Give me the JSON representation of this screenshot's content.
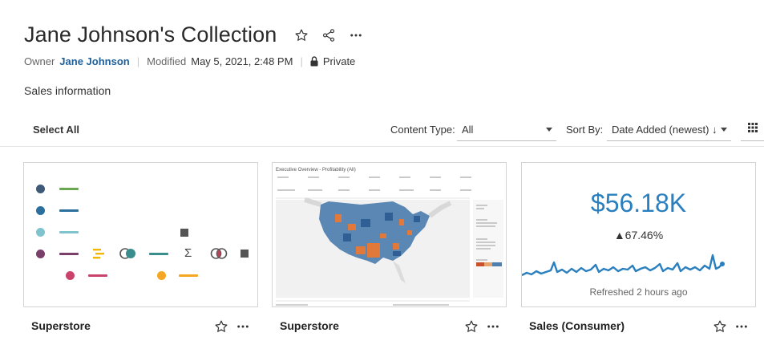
{
  "header": {
    "title": "Jane Johnson's Collection",
    "owner_label": "Owner",
    "owner_name": "Jane Johnson",
    "modified_label": "Modified",
    "modified_value": "May 5, 2021, 2:48 PM",
    "privacy": "Private",
    "description": "Sales information",
    "icons": [
      "star-icon",
      "share-icon",
      "more-icon",
      "lock-icon"
    ]
  },
  "toolbar": {
    "select_all": "Select All",
    "content_type_label": "Content Type:",
    "content_type_value": "All",
    "sort_by_label": "Sort By:",
    "sort_by_value": "Date Added (newest) ↓",
    "icons": [
      "grid-view-icon",
      "chevron-down-icon"
    ]
  },
  "cards": [
    {
      "name": "Superstore",
      "type": "icon-legend"
    },
    {
      "name": "Superstore",
      "type": "dashboard",
      "dashboard_title": "Executive Overview - Profitability (All)"
    },
    {
      "name": "Sales (Consumer)",
      "type": "metric",
      "value": "$56.18K",
      "change": "▲67.46%",
      "refreshed": "Refreshed 2 hours ago",
      "line_color": "#2a7fbf"
    }
  ],
  "colors": {
    "accent": "#1f5f9a",
    "kpi": "#2a7fbf",
    "map_blue": "#4f7fae",
    "map_orange": "#e0793a"
  }
}
